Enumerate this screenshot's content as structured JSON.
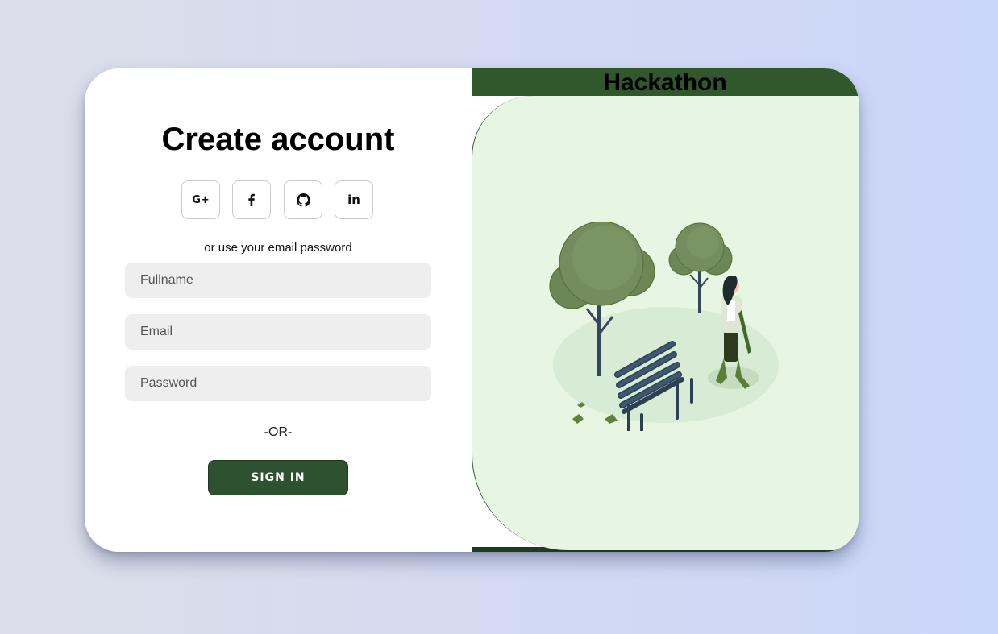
{
  "signup": {
    "title": "Create account",
    "social": [
      {
        "name": "google-plus",
        "icon": "google-plus-icon",
        "label": "G+"
      },
      {
        "name": "facebook",
        "icon": "facebook-icon"
      },
      {
        "name": "github",
        "icon": "github-icon"
      },
      {
        "name": "linkedin",
        "icon": "linkedin-icon",
        "label": "in"
      }
    ],
    "subtext": "or use your email password",
    "fields": {
      "fullname_placeholder": "Fullname",
      "email_placeholder": "Email",
      "password_placeholder": "Password"
    },
    "or_text": "-OR-",
    "signin_label": "SIGN IN"
  },
  "panel": {
    "brand": "Hackathon",
    "illustration": "park-bench-woman-walking-illustration"
  },
  "colors": {
    "primary": "#31572c",
    "panel_bg": "#e6f6e3",
    "field_bg": "#eeeeee"
  }
}
